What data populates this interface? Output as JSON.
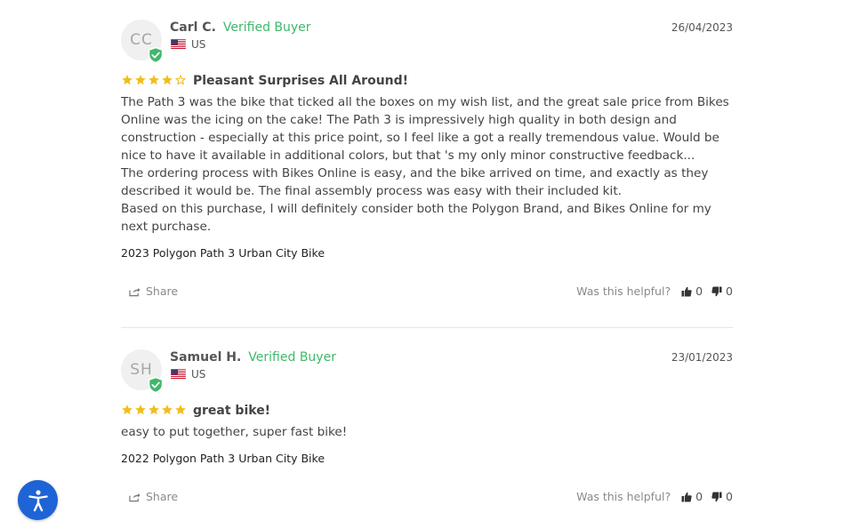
{
  "colors": {
    "verified": "#3fb86b",
    "star": "#f2bd1b",
    "accessibility": "#1e64d6"
  },
  "reviews": [
    {
      "initials": "CC",
      "name": "Carl C.",
      "verified_label": "Verified Buyer",
      "country": "US",
      "date": "26/04/2023",
      "rating": 4,
      "title": "Pleasant Surprises All Around!",
      "body": [
        "The Path 3 was the bike that ticked all the boxes on my wish list, and the great sale price from Bikes Online was the icing on the cake! The Path 3 is impressively high quality in both design and construction - especially at this price point, so I feel like a got a really tremendous value. Would be nice to have it available in additional colors, but that 's my only minor constructive feedback...",
        "The ordering process with Bikes Online is easy, and the bike arrived on time, and exactly as they described it would be. The final assembly process was easy with their included kit.",
        "Based on this purchase, I will definitely consider both the Polygon Brand, and Bikes Online for my next purchase."
      ],
      "product": "2023 Polygon Path 3 Urban City Bike",
      "share_label": "Share",
      "helpful_label": "Was this helpful?",
      "up_count": "0",
      "down_count": "0"
    },
    {
      "initials": "SH",
      "name": "Samuel H.",
      "verified_label": "Verified Buyer",
      "country": "US",
      "date": "23/01/2023",
      "rating": 5,
      "title": "great bike!",
      "body": [
        "easy to put together, super fast bike!"
      ],
      "product": "2022 Polygon Path 3 Urban City Bike",
      "share_label": "Share",
      "helpful_label": "Was this helpful?",
      "up_count": "0",
      "down_count": "0"
    }
  ]
}
